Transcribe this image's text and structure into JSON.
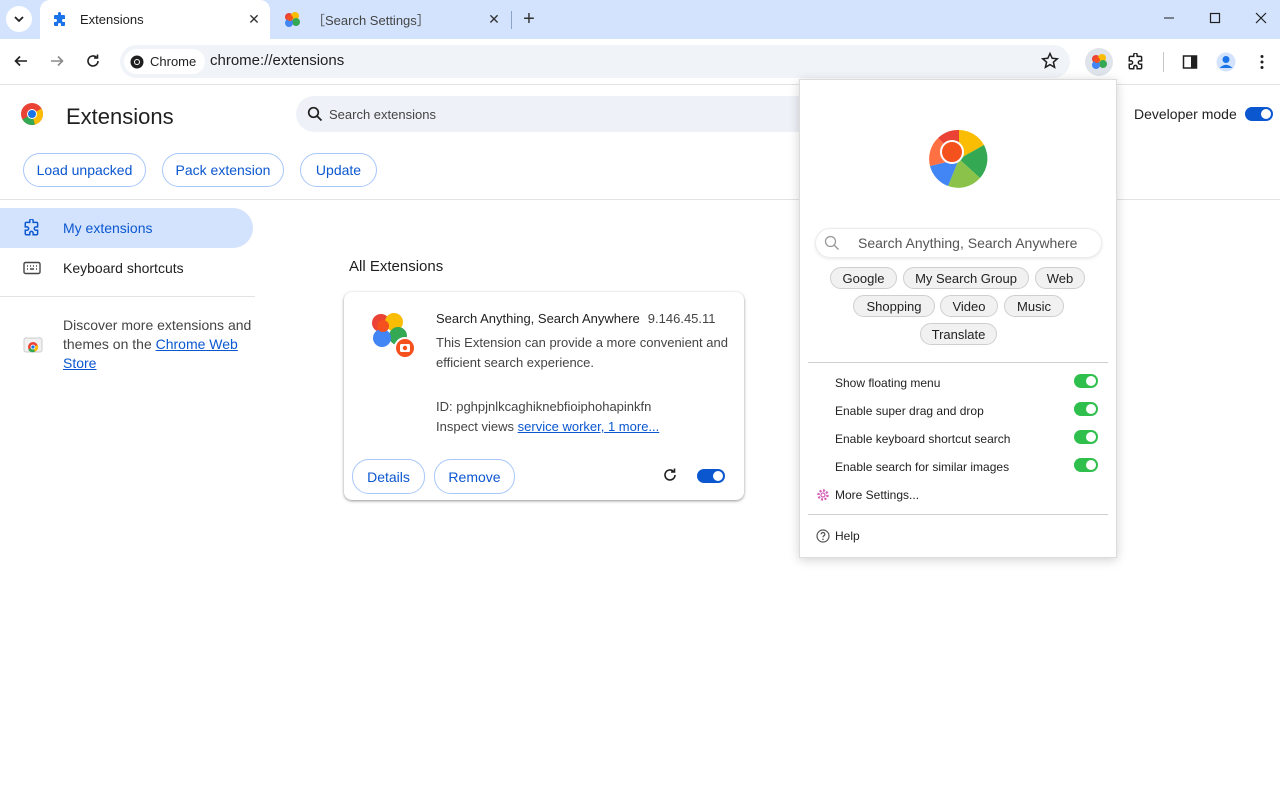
{
  "tabs": [
    {
      "title": "Extensions",
      "active": true,
      "favicon": "puzzle-icon"
    },
    {
      "title": "［Search Settings］",
      "active": false,
      "favicon": "colorful-flower-icon"
    }
  ],
  "toolbar": {
    "chip_label": "Chrome",
    "url": "chrome://extensions"
  },
  "page": {
    "title": "Extensions",
    "search_placeholder": "Search extensions",
    "developer_mode_label": "Developer mode",
    "developer_mode_on": true,
    "buttons": {
      "load_unpacked": "Load unpacked",
      "pack_extension": "Pack extension",
      "update": "Update"
    }
  },
  "sidebar": {
    "items": [
      {
        "label": "My extensions",
        "active": true,
        "icon": "extension-icon"
      },
      {
        "label": "Keyboard shortcuts",
        "active": false,
        "icon": "keyboard-icon"
      }
    ],
    "discover_text": "Discover more extensions and themes on the ",
    "discover_link": "Chrome Web Store"
  },
  "main": {
    "section_title": "All Extensions",
    "card": {
      "name": "Search Anything, Search Anywhere",
      "version": "9.146.45.11",
      "description": "This Extension can provide a more convenient and efficient search experience.",
      "id_label": "ID: pghpjnlkcaghiknebfioiphohapinkfn",
      "inspect_label": "Inspect views ",
      "inspect_link": "service worker, 1 more...",
      "details_label": "Details",
      "remove_label": "Remove",
      "enabled": true
    }
  },
  "popup": {
    "search_placeholder": "Search Anything, Search Anywhere",
    "pills": [
      "Google",
      "My Search Group",
      "Web",
      "Shopping",
      "Video",
      "Music",
      "Translate"
    ],
    "settings": [
      {
        "label": "Show floating menu",
        "on": true
      },
      {
        "label": "Enable super drag and drop",
        "on": true
      },
      {
        "label": "Enable keyboard shortcut search",
        "on": true
      },
      {
        "label": "Enable search for similar images",
        "on": true
      }
    ],
    "more_settings": "More Settings...",
    "help": "Help"
  },
  "colors": {
    "accent": "#0b57d0",
    "tabstrip": "#d3e3fd",
    "toggle_green": "#2fbf4c"
  }
}
